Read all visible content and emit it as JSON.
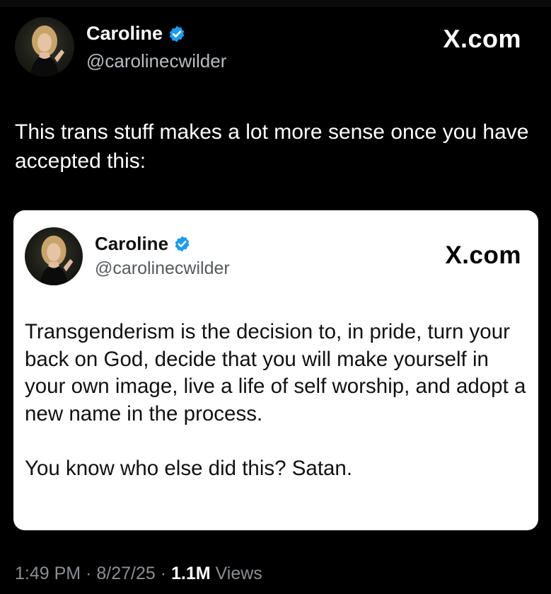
{
  "post": {
    "author_name": "Caroline",
    "author_handle": "@carolinecwilder",
    "brand_label": "X.com",
    "text": "This trans stuff makes a lot more sense once you have accepted this:"
  },
  "quoted": {
    "author_name": "Caroline",
    "author_handle": "@carolinecwilder",
    "brand_label": "X.com",
    "paragraphs": [
      "Transgenderism is the decision to, in pride, turn your back on God, decide that you will make yourself in your own image, live a life of self worship, and adopt a new name in the process.",
      "You know who else did this? Satan."
    ]
  },
  "meta": {
    "time": "1:49 PM",
    "separator": "·",
    "date": "8/27/25",
    "views_count": "1.1M",
    "views_label": "Views"
  },
  "colors": {
    "verified_badge": "#1d9bf0",
    "background": "#000000",
    "card": "#ffffff",
    "secondary_text": "#8a8f94"
  },
  "icons": {
    "verified": "verified-badge-icon"
  }
}
